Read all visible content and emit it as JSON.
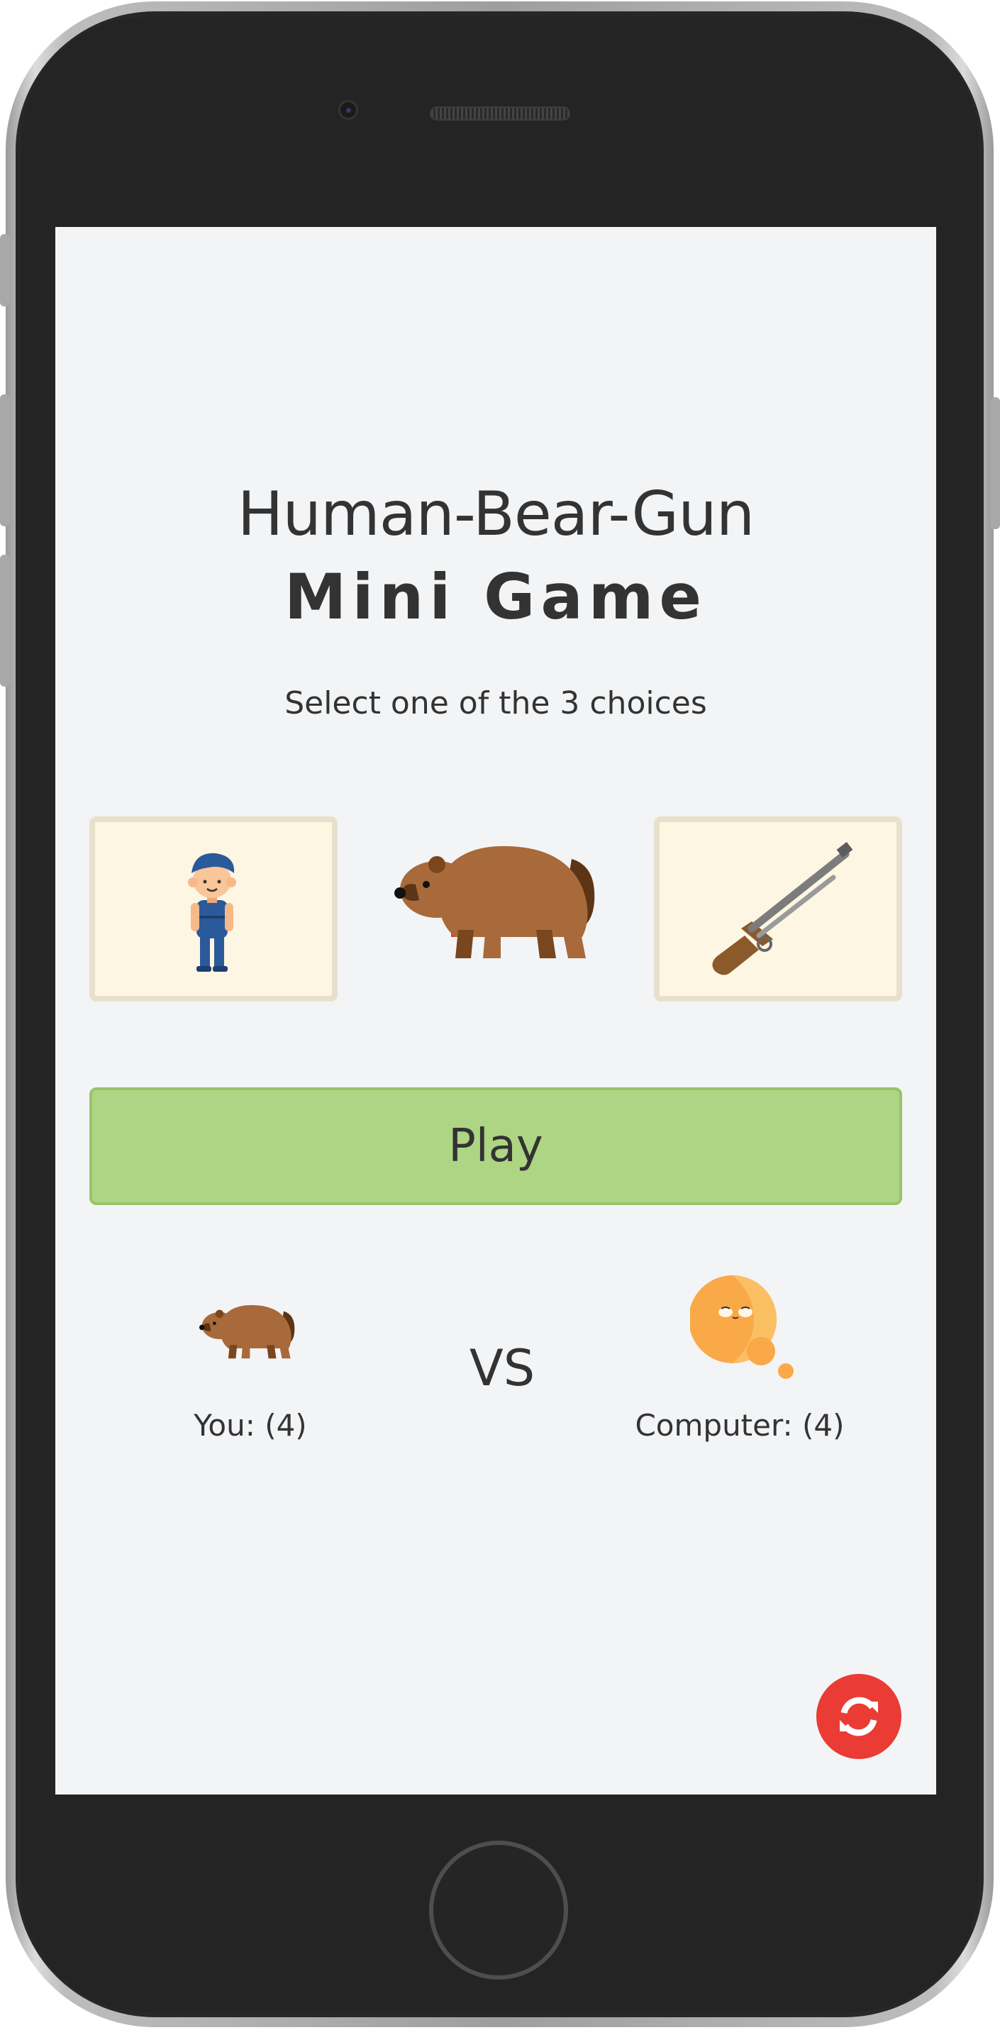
{
  "header": {
    "title_line1": "Human-Bear-Gun",
    "title_line2": "Mini Game"
  },
  "instructions": "Select one of the 3 choices",
  "choices": [
    {
      "name": "human",
      "icon": "human-icon",
      "selected": false
    },
    {
      "name": "bear",
      "icon": "bear-icon",
      "selected": true
    },
    {
      "name": "gun",
      "icon": "gun-icon",
      "selected": false
    }
  ],
  "play_button": {
    "label": "Play"
  },
  "scoreboard": {
    "vs_label": "VS",
    "player": {
      "label": "You: (4)",
      "choice_icon": "bear-icon"
    },
    "computer": {
      "label": "Computer: (4)",
      "choice_icon": "thinking-icon"
    }
  },
  "reset_button": {
    "icon": "refresh-icon"
  },
  "colors": {
    "screen_bg": "#f3f4f6",
    "choice_bg": "#fdf6e3",
    "choice_border": "#e7e0cb",
    "play_bg": "#aed583",
    "reset_bg": "#ea3b34"
  }
}
